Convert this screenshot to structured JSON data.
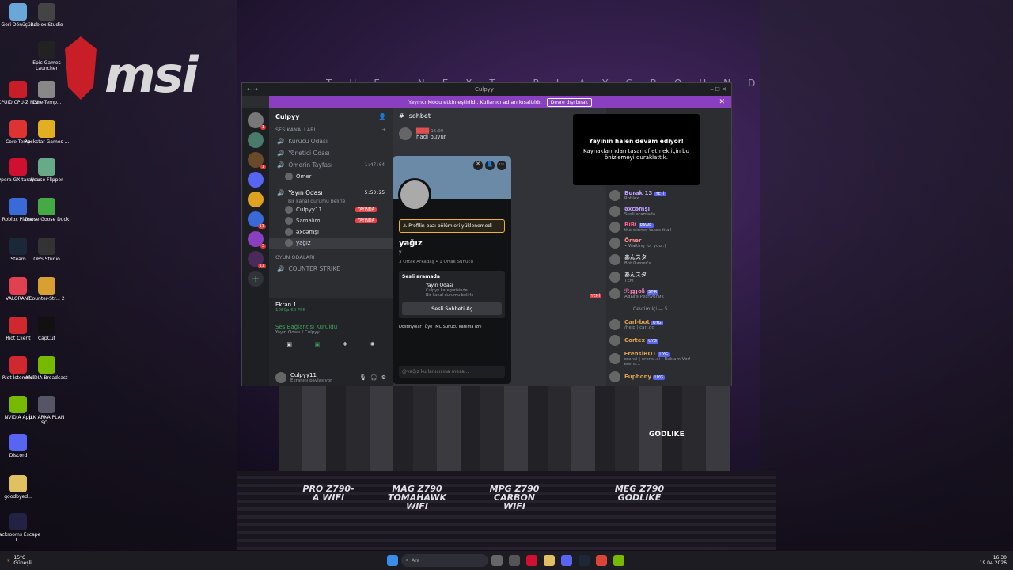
{
  "desktop_icons": [
    {
      "label": "Geri Dönüşü...",
      "color": "#6aa6d8"
    },
    {
      "label": "Roblox Studio",
      "color": "#444"
    },
    {
      "label": "Epic Games Launcher",
      "color": "#222"
    },
    {
      "label": "CPUID CPU-Z MSI",
      "color": "#c81e28"
    },
    {
      "label": "Core-Temp...",
      "color": "#888"
    },
    {
      "label": "Core Temp",
      "color": "#d33"
    },
    {
      "label": "Rockstar Games ...",
      "color": "#e0b020"
    },
    {
      "label": "Opera GX tarayıcı",
      "color": "#d01030"
    },
    {
      "label": "House Flipper",
      "color": "#6a8"
    },
    {
      "label": "Roblox Player",
      "color": "#3a6ad8"
    },
    {
      "label": "Goose Goose Duck",
      "color": "#4a4"
    },
    {
      "label": "Steam",
      "color": "#1b2838"
    },
    {
      "label": "OBS Studio",
      "color": "#333"
    },
    {
      "label": "VALORANT",
      "color": "#e04050"
    },
    {
      "label": "Counter-Str... 2",
      "color": "#d8a030"
    },
    {
      "label": "Riot Client",
      "color": "#d0282f"
    },
    {
      "label": "CapCut",
      "color": "#111"
    },
    {
      "label": "Riot İstemcisi",
      "color": "#d0282f"
    },
    {
      "label": "NVIDIA Broadcast",
      "color": "#76b900"
    },
    {
      "label": "NVIDIA App",
      "color": "#76b900"
    },
    {
      "label": "İLK ARKA PLAN SO...",
      "color": "#556"
    },
    {
      "label": "Discord",
      "color": "#5865f2"
    },
    {
      "label": "goodbyed...",
      "color": "#e0c060"
    },
    {
      "label": "Backrooms Escape T...",
      "color": "#224"
    }
  ],
  "background": {
    "brand": "msi",
    "tagline": "THE NEXT PLAYGROUND",
    "products": [
      "PRO Z790-A WIFI",
      "MAG Z790 TOMAHAWK WIFI",
      "MPG Z790 CARBON WIFI",
      "MEG Z790 GODLIKE"
    ],
    "board_label": "GODLIKE"
  },
  "window": {
    "title": "Culpyy",
    "banner_text": "Yayıncı Modu etkinleştirildi. Kullanıcı adları kısaltıldı.",
    "banner_button": "Devre dışı bırak"
  },
  "channels": {
    "server_name": "Culpyy",
    "cat_voice": "SES KANALLARI",
    "voice": [
      {
        "name": "Kurucu Odası"
      },
      {
        "name": "Yönetici Odası"
      },
      {
        "name": "Ömerin Tayfası",
        "time": "1:47:04"
      }
    ],
    "omer_user": "Ömer",
    "yayin": {
      "name": "Yayın Odası",
      "time": "5:50:25",
      "sub": "Bir kanal durumu belirle"
    },
    "yayin_users": [
      {
        "name": "Culpyy11",
        "live": "YAYINDA"
      },
      {
        "name": "Samalım",
        "live": "YAYINDA"
      },
      {
        "name": "əxcəmşı"
      },
      {
        "name": "yağız"
      }
    ],
    "cat_game": "OYUN ODALARI",
    "counter": "COUNTER STRIKE",
    "stream": {
      "title": "Ekran 1",
      "sub": "1080p 60 FPS"
    },
    "voice_conn": {
      "title": "Ses Bağlantısı Kuruldu",
      "sub": "Yayın Odası / Culpyy"
    },
    "me": {
      "name": "Culpyy11",
      "status": "Ekranını paylaşıyor"
    }
  },
  "main": {
    "channel": "sohbet",
    "msg_time": "15:00",
    "msg_text": "hadi buyur",
    "new_tag": "YENİ"
  },
  "popup": {
    "warning": "Profilin bazı bölümleri yüklenemedi",
    "name": "yağız",
    "sub": "y...",
    "mutual": "3 Ortak Arkadaş • 1 Ortak Sunucu",
    "voice_label": "Sesli aramada",
    "voice_room": "Yayın Odası",
    "voice_cat": "Culpyy kategorisinde",
    "voice_status": "Bir kanal durumu belirle",
    "join": "Sesli Sohbeti Aç",
    "roles": [
      "Dostinyolar",
      "Üye",
      "MC Sunucu katılma izni"
    ],
    "input_placeholder": "@yağız kullanıcısına mesa..."
  },
  "overlay": {
    "title": "Yayının halen devam ediyor!",
    "text": "Kaynaklarından tasarruf etmek için bu önizlemeyi duraklattık."
  },
  "members": {
    "list": [
      {
        "name": "Burak 13",
        "status": "Roblox",
        "tag": "YETİ",
        "color": "#c0a0ff"
      },
      {
        "name": "əxcəmşı",
        "status": "Sesli aramada",
        "color": "#c0a0ff"
      },
      {
        "name": "BiBi",
        "status": "the winner takes it all",
        "tag": "RAWR",
        "color": "#ff6090"
      },
      {
        "name": "Ömer",
        "status": "• Waiting for you :)",
        "color": "#ff9090"
      },
      {
        "name": "あんスタ",
        "status": "Bot Owner's",
        "color": "#ddd"
      },
      {
        "name": "あんスタ",
        "status": "TEM",
        "color": "#ddd"
      },
      {
        "name": "ℛ¡ȿ¡oჩ",
        "status": "Адыгэ Республик",
        "tag": "ST-R",
        "color": "#ff80c0"
      }
    ],
    "online_header": "Çevrim İçi — 5",
    "bots": [
      {
        "name": "Carl-bot",
        "status": "/help | carl.gg",
        "tag": "UYG"
      },
      {
        "name": "Cortex",
        "tag": "UYG"
      },
      {
        "name": "ErensiBOT",
        "status": "erensi | erensi.ai | Reklam Ver! erens...",
        "tag": "UYG"
      },
      {
        "name": "Euphony",
        "tag": "UYG"
      }
    ]
  },
  "taskbar": {
    "weather": "15°C",
    "weather_sub": "Güneşli",
    "search": "Ara",
    "time": "16:30",
    "date": "19.04.2026"
  }
}
